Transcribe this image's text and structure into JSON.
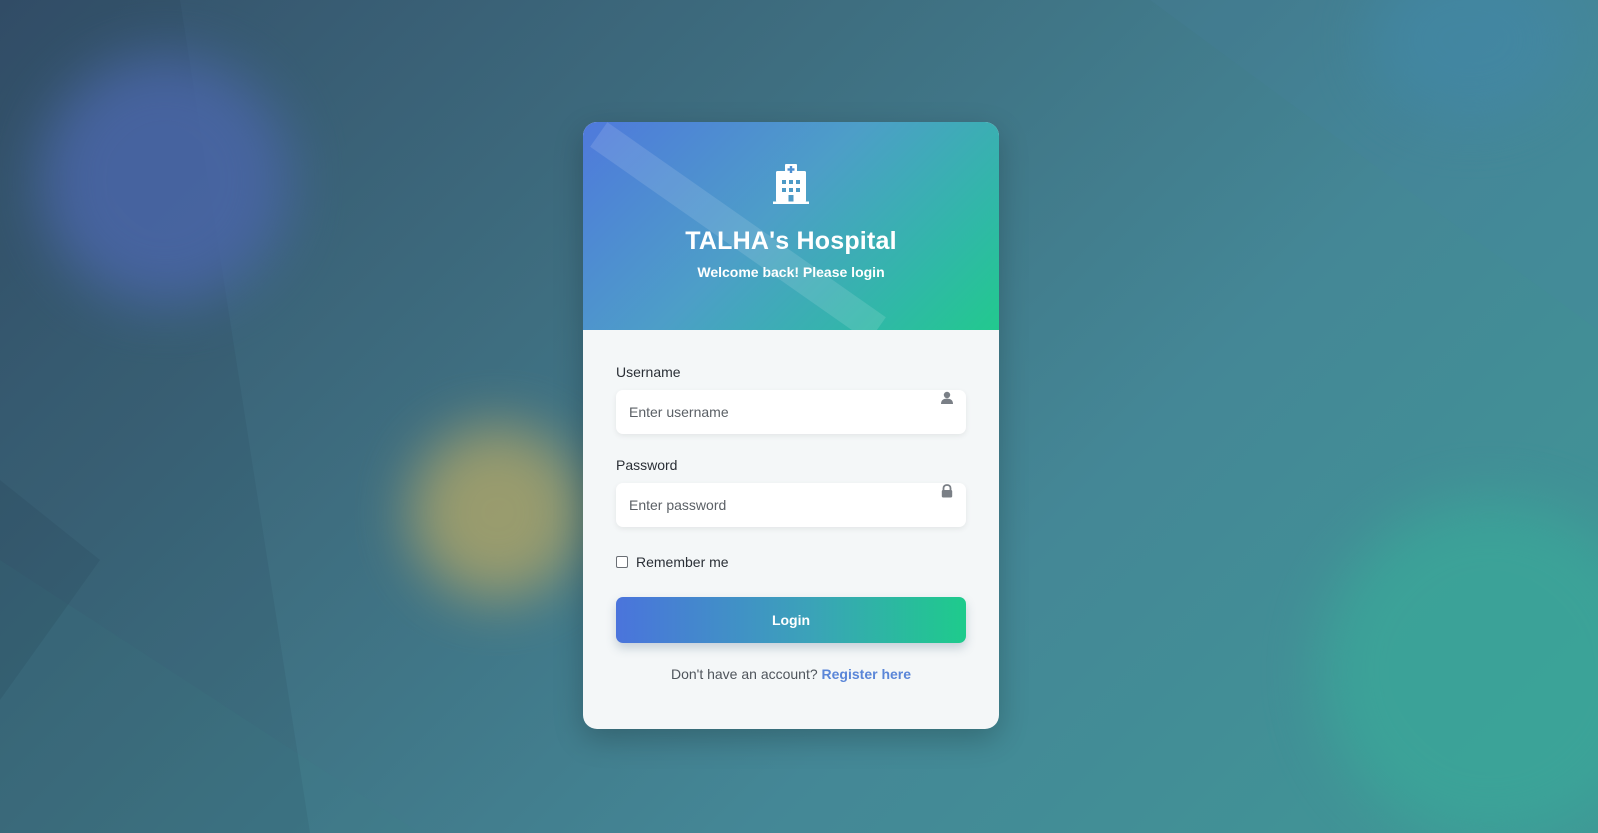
{
  "header": {
    "icon": "hospital-icon",
    "title": "TALHA's Hospital",
    "subtitle": "Welcome back! Please login"
  },
  "form": {
    "username": {
      "label": "Username",
      "placeholder": "Enter username",
      "value": "",
      "icon": "user-icon"
    },
    "password": {
      "label": "Password",
      "placeholder": "Enter password",
      "value": "",
      "icon": "lock-icon"
    },
    "remember": {
      "label": "Remember me",
      "checked": false
    },
    "submit_label": "Login"
  },
  "footer": {
    "prompt": "Don't have an account?",
    "link_label": "Register here"
  },
  "colors": {
    "gradient_start": "#4f79dc",
    "gradient_end": "#22c98e",
    "link": "#5a86d8",
    "card_bg": "#f4f7f8"
  }
}
